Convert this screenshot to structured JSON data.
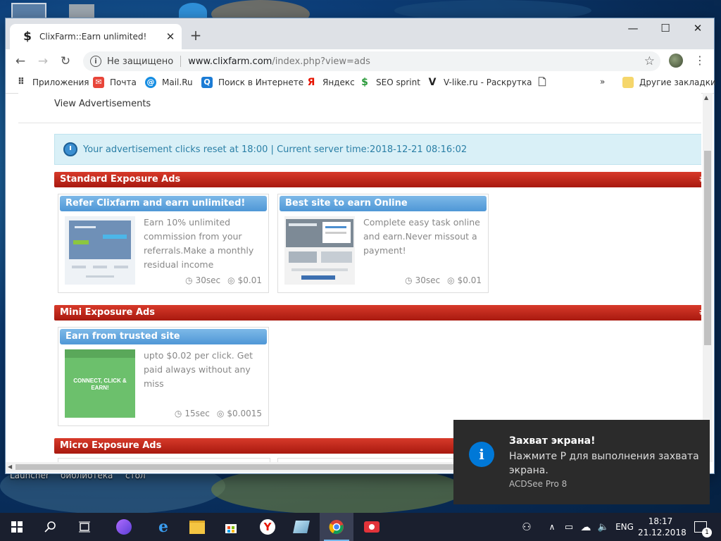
{
  "desktop": {
    "labels": [
      "Launcher",
      "библиотека",
      "стол"
    ]
  },
  "browser": {
    "tab_title": "ClixFarm::Earn unlimited!",
    "tab_favicon": "$",
    "omnibox": {
      "security": "Не защищено",
      "host": "www.clixfarm.com",
      "path": "/index.php?view=ads"
    },
    "bookmarks": [
      {
        "label": "Приложения",
        "icon": "apps-icon"
      },
      {
        "label": "Почта",
        "icon": "mail-icon"
      },
      {
        "label": "Mail.Ru",
        "icon": "mailru-icon"
      },
      {
        "label": "Поиск в Интернете",
        "icon": "search-icon"
      },
      {
        "label": "Яндекс",
        "icon": "yandex-icon"
      },
      {
        "label": "SEO sprint",
        "icon": "seosprint-icon"
      },
      {
        "label": "V-like.ru - Раскрутка",
        "icon": "vlike-icon"
      },
      {
        "label": "Другие закладки",
        "icon": "folder-icon"
      }
    ],
    "bookmarks_overflow": "»"
  },
  "page": {
    "title": "View Advertisements",
    "notice": "Your advertisement clicks reset at 18:00 | Current server time:2018-12-21 08:16:02",
    "sections": [
      {
        "name": "Standard Exposure Ads",
        "hash": "#",
        "ads": [
          {
            "title": "Refer Clixfarm and earn unlimited!",
            "desc": "Earn 10% unlimited commission from your referrals.Make a monthly residual income",
            "time": "30sec",
            "price": "$0.01"
          },
          {
            "title": "Best site to earn Online",
            "desc": "Complete easy task online and earn.Never missout a payment!",
            "time": "30sec",
            "price": "$0.01"
          }
        ]
      },
      {
        "name": "Mini Exposure Ads",
        "hash": "#",
        "ads": [
          {
            "title": "Earn from trusted site",
            "desc": "upto $0.02 per click. Get paid always without any miss",
            "time": "15sec",
            "price": "$0.0015",
            "thumb_text": "CONNECT, CLICK & EARN!"
          }
        ]
      },
      {
        "name": "Micro Exposure Ads",
        "hash": "#",
        "ads": []
      }
    ]
  },
  "toast": {
    "title": "Захват экрана!",
    "body": "Нажмите P для выполнения захвата экрана.",
    "source": "ACDSee Pro 8",
    "icon": "i"
  },
  "taskbar": {
    "lang": "ENG",
    "time": "18:17",
    "date": "21.12.2018",
    "notif_count": "1"
  },
  "colors": {
    "section_red": "#c0281b",
    "ad_head_blue": "#5fa4dd",
    "notice_bg": "#d9f0f7",
    "toast_bg": "#2b2b2b",
    "taskbar_bg": "#1a1f2e"
  }
}
